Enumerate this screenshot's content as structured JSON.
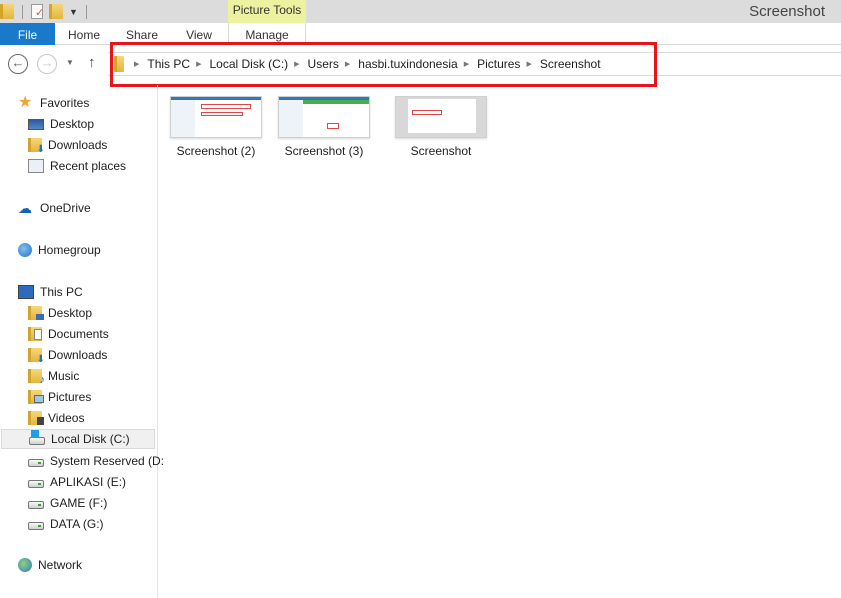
{
  "window": {
    "title": "Screenshot",
    "contextual_tab_group": "Picture Tools"
  },
  "quick_access_toolbar": {
    "icons": [
      "folder-icon",
      "properties-icon",
      "new-folder-icon",
      "customize-dropdown-icon"
    ]
  },
  "ribbon": {
    "tabs": [
      {
        "label": "File",
        "active": true
      },
      {
        "label": "Home"
      },
      {
        "label": "Share"
      },
      {
        "label": "View"
      },
      {
        "label": "Manage"
      }
    ]
  },
  "navigation": {
    "back_icon": "back-arrow-icon",
    "forward_icon": "forward-arrow-icon",
    "recent_icon": "chevron-down-icon",
    "up_icon": "up-arrow-icon"
  },
  "address_bar": {
    "breadcrumbs": [
      "This PC",
      "Local Disk (C:)",
      "Users",
      "hasbi.tuxindonesia",
      "Pictures",
      "Screenshot"
    ],
    "highlight_color": "#e8141c"
  },
  "sidebar": {
    "favorites": {
      "label": "Favorites",
      "items": [
        "Desktop",
        "Downloads",
        "Recent places"
      ]
    },
    "onedrive": "OneDrive",
    "homegroup": "Homegroup",
    "this_pc": {
      "label": "This PC",
      "items": [
        "Desktop",
        "Documents",
        "Downloads",
        "Music",
        "Pictures",
        "Videos",
        "Local Disk (C:)",
        "System Reserved (D:",
        "APLIKASI (E:)",
        "GAME (F:)",
        "DATA (G:)"
      ],
      "selected": "Local Disk (C:)"
    },
    "network": "Network"
  },
  "files": [
    {
      "name": "Screenshot (2)"
    },
    {
      "name": "Screenshot (3)"
    },
    {
      "name": "Screenshot"
    }
  ],
  "colors": {
    "file_tab": "#1979ca",
    "picture_tools": "#ecf2a0"
  }
}
